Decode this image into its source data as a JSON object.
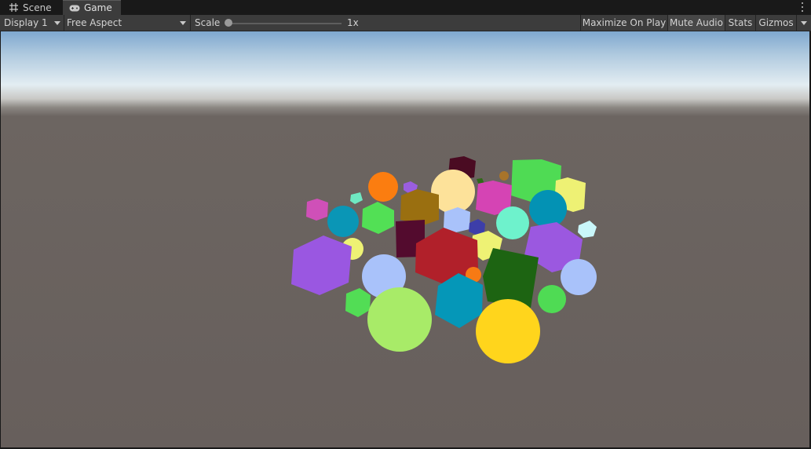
{
  "tabs": [
    {
      "label": "Scene",
      "icon": "hash-grid-icon",
      "active": false
    },
    {
      "label": "Game",
      "icon": "gamepad-icon",
      "active": true
    }
  ],
  "toolbar": {
    "display": "Display 1",
    "aspect": "Free Aspect",
    "scale_label": "Scale",
    "scale_value": "1x",
    "maximize_on_play": "Maximize On Play",
    "mute_audio": "Mute Audio",
    "stats": "Stats",
    "gizmos": "Gizmos"
  },
  "scene": {
    "sky_color": "#7fa8cf",
    "horizon_color": "#e3edf2",
    "ground_color": "#675f5c"
  }
}
